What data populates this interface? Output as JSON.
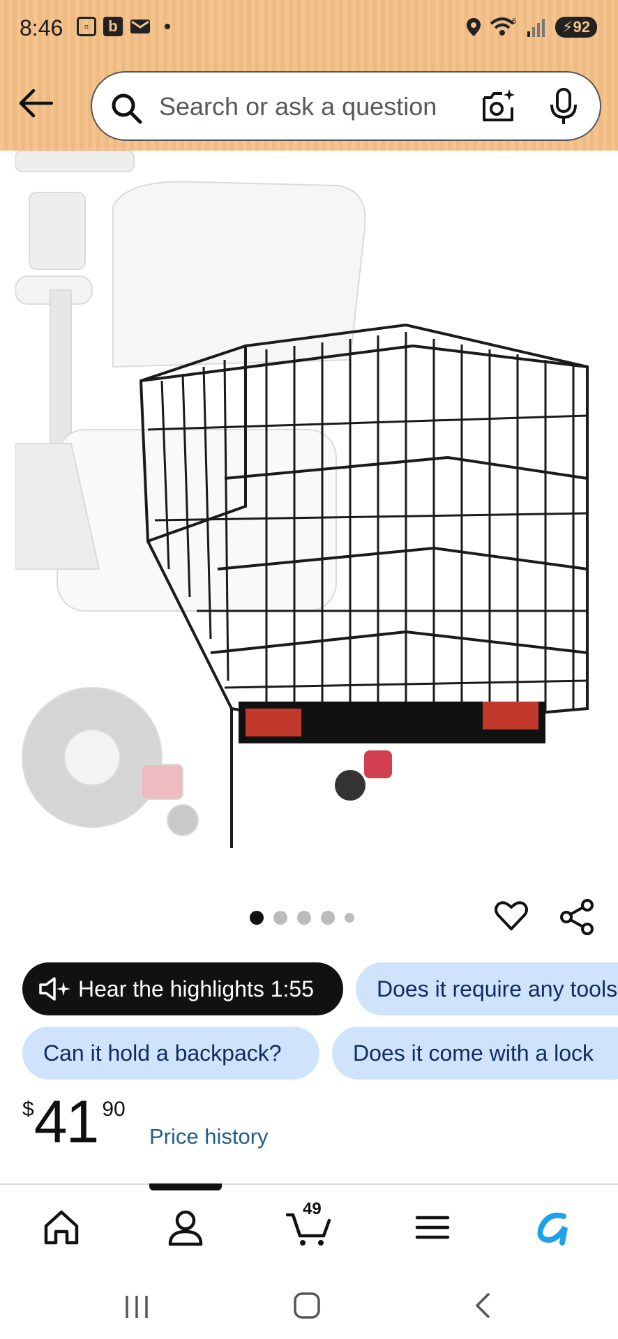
{
  "status_bar": {
    "time": "8:46",
    "notif_b": "b",
    "battery": "92",
    "signal_label": "5"
  },
  "search": {
    "placeholder": "Search or ask a question"
  },
  "carousel": {
    "total_dots": 5,
    "active_index": 0
  },
  "chips": {
    "highlights_label": "Hear the highlights 1:55",
    "q1": "Does it require any tools",
    "q2": "Can it hold a backpack?",
    "q3": "Does it come with a lock"
  },
  "price": {
    "symbol": "$",
    "whole": "41",
    "fraction": "90",
    "history_label": "Price history"
  },
  "bottom_nav": {
    "cart_count": "49"
  },
  "colors": {
    "header_band": "#f4c48e",
    "chip_blue": "#cfe4fb",
    "price_history_link": "#1f5e8c",
    "rufus_accent": "#1fa1e8"
  }
}
